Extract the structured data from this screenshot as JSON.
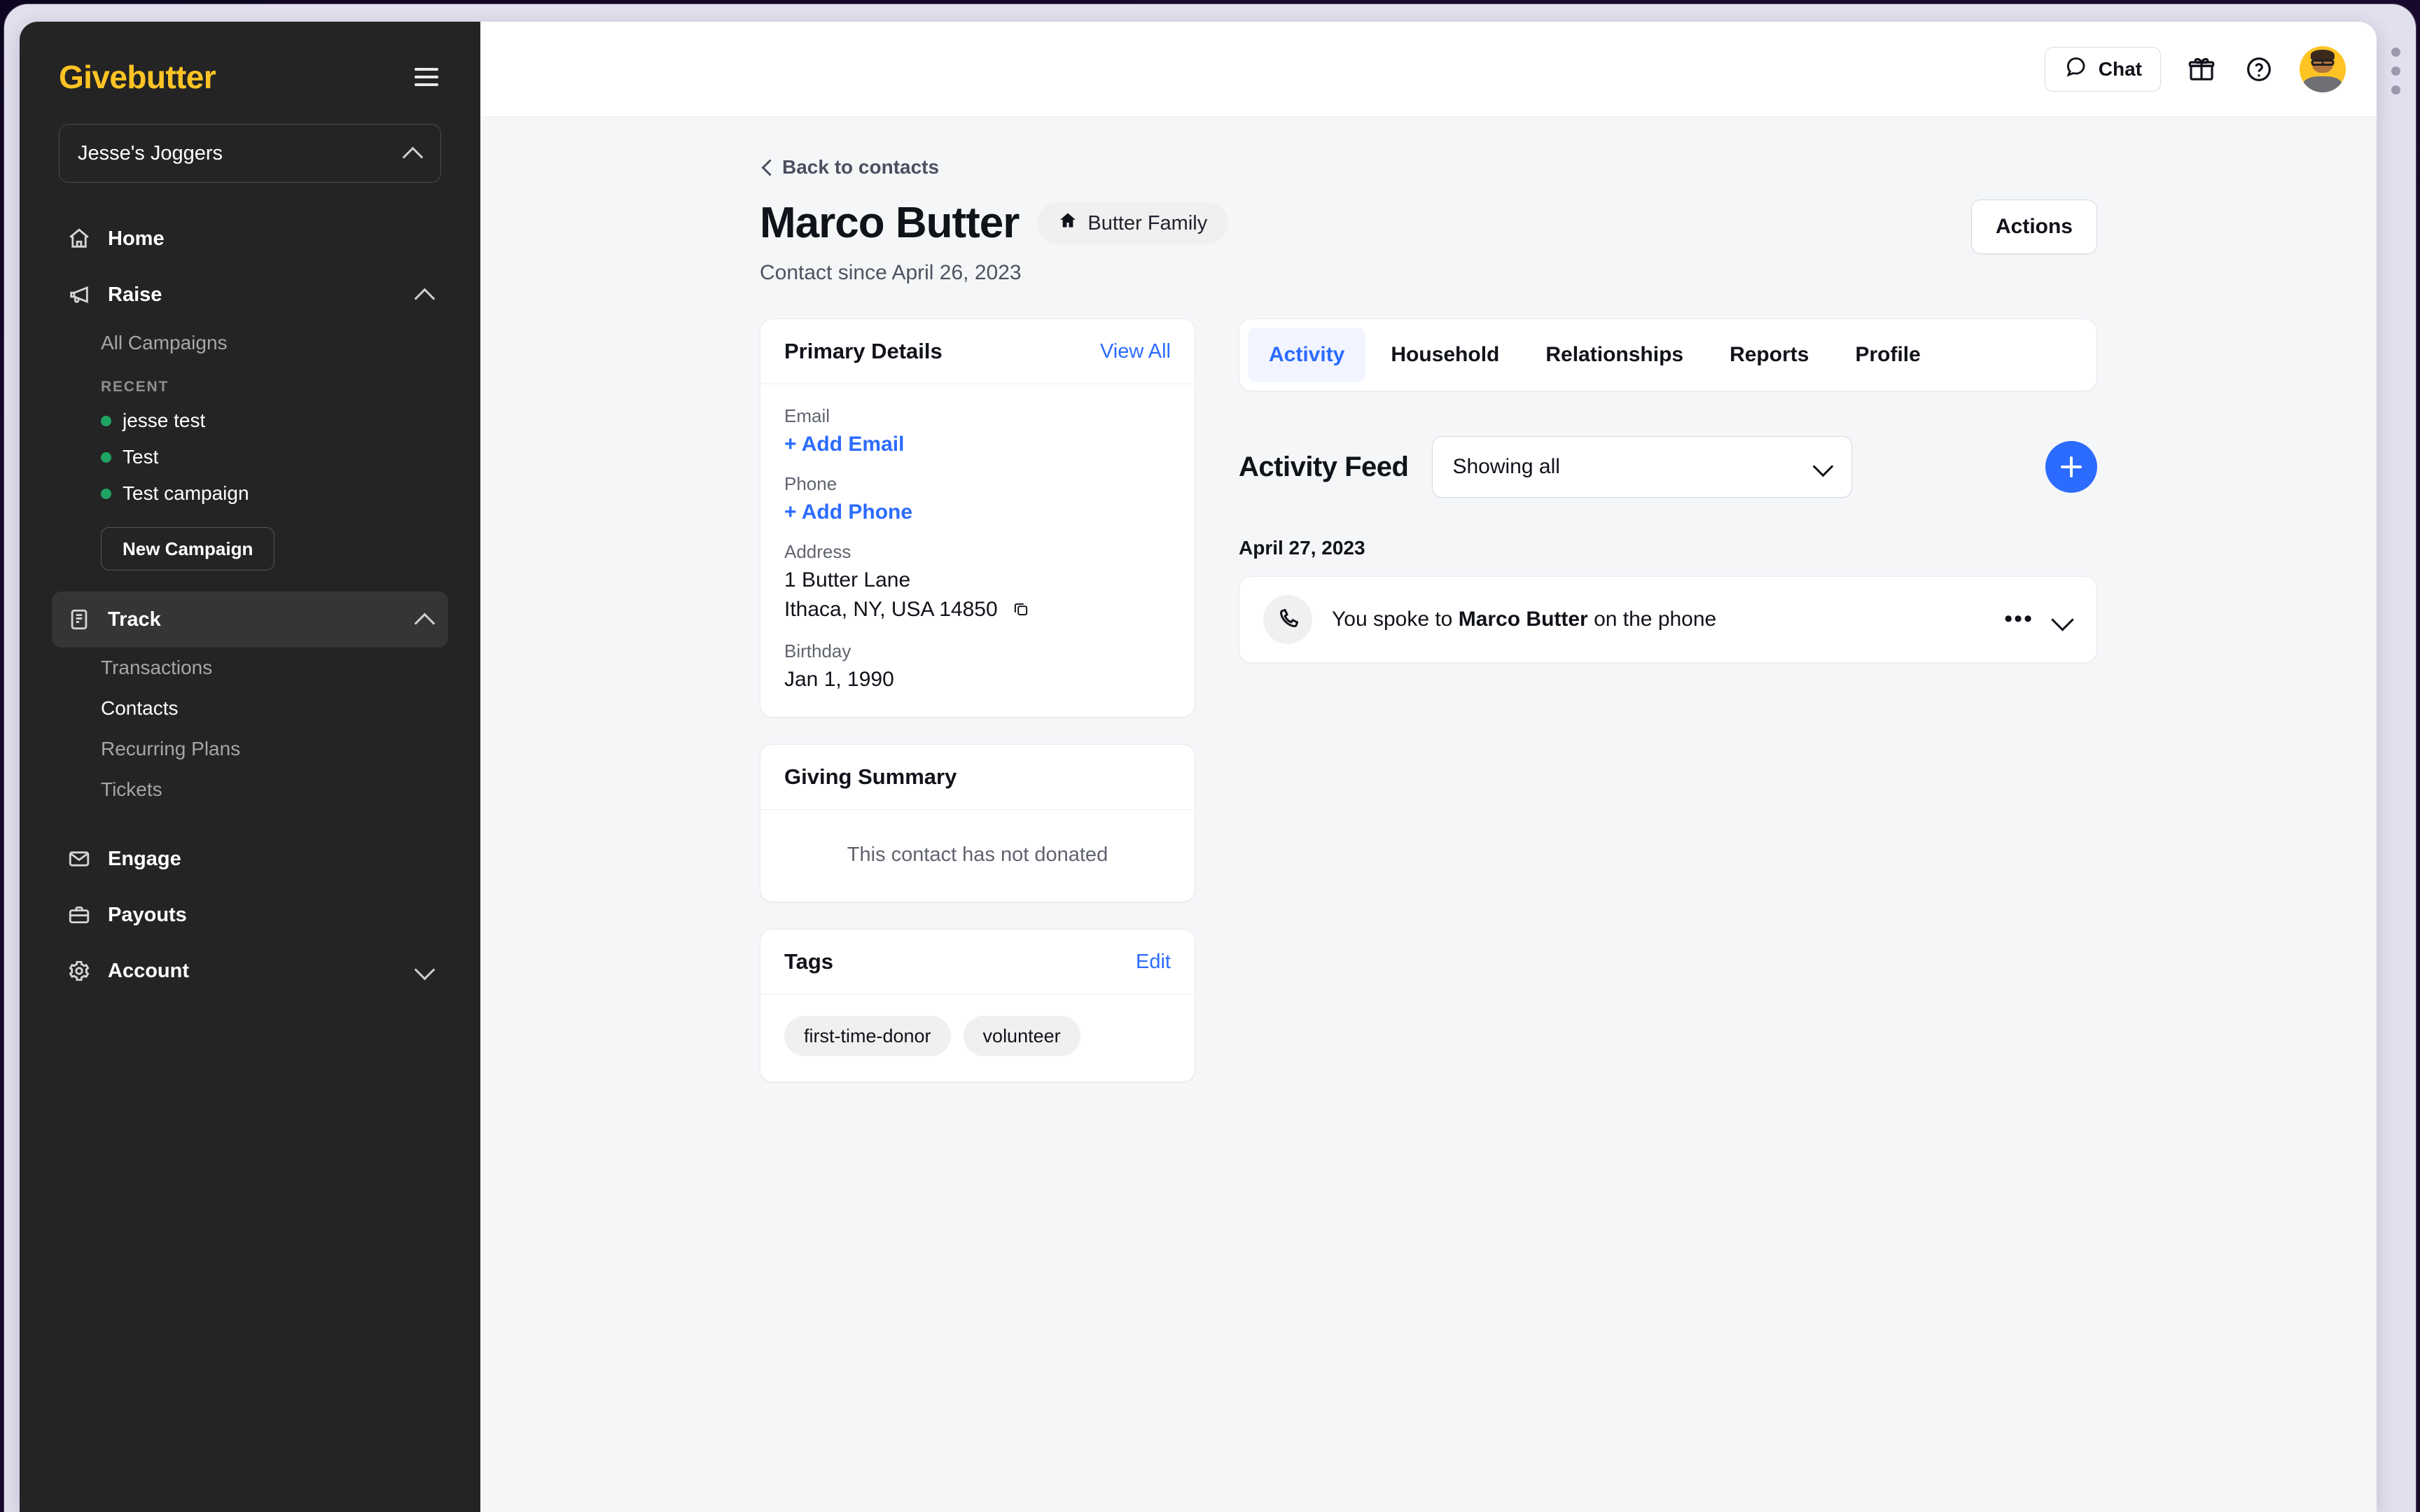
{
  "sidebar": {
    "brand": "Givebutter",
    "menu_icon": "hamburger-icon",
    "org": {
      "name": "Jesse's Joggers",
      "chevron": "chevron-up-icon"
    },
    "nav": {
      "home": "Home",
      "raise": "Raise",
      "all_campaigns": "All Campaigns",
      "recent_header": "RECENT",
      "recent": [
        "jesse test",
        "Test",
        "Test campaign"
      ],
      "new_campaign": "New Campaign",
      "track": "Track",
      "track_items": [
        "Transactions",
        "Contacts",
        "Recurring Plans",
        "Tickets"
      ],
      "engage": "Engage",
      "payouts": "Payouts",
      "account": "Account"
    },
    "active_item": "Contacts",
    "dot_color": "#1fa463",
    "brand_color": "#ffc424"
  },
  "topbar": {
    "chat_label": "Chat",
    "chat_icon": "chat-bubble-icon",
    "gift_icon": "gift-icon",
    "help_icon": "help-circle-icon",
    "avatar": "user-avatar"
  },
  "page": {
    "back_label": "Back to contacts",
    "contact_name": "Marco Butter",
    "household_label": "Butter Family",
    "household_icon": "home-icon",
    "since": "Contact since April 26, 2023",
    "actions_label": "Actions"
  },
  "primary_details": {
    "title": "Primary Details",
    "view_all": "View All",
    "fields": [
      {
        "label": "Email",
        "value": "+ Add Email",
        "type": "add"
      },
      {
        "label": "Phone",
        "value": "+ Add Phone",
        "type": "add"
      },
      {
        "label": "Address",
        "value": "1 Butter Lane",
        "value2": "Ithaca, NY, USA 14850",
        "type": "address",
        "copy_icon": "copy-icon"
      },
      {
        "label": "Birthday",
        "value": "Jan 1, 1990",
        "type": "text"
      }
    ]
  },
  "giving_summary": {
    "title": "Giving Summary",
    "empty_text": "This contact has not donated"
  },
  "tags_card": {
    "title": "Tags",
    "edit": "Edit",
    "tags": [
      "first-time-donor",
      "volunteer"
    ]
  },
  "tabs": {
    "items": [
      "Activity",
      "Household",
      "Relationships",
      "Reports",
      "Profile"
    ],
    "active": "Activity"
  },
  "activity": {
    "title": "Activity Feed",
    "filter_value": "Showing all",
    "filter_chevron": "chevron-down-icon",
    "add_icon": "plus-icon",
    "date_group": "April 27, 2023",
    "items": [
      {
        "icon": "phone-icon",
        "text_before": "You spoke to ",
        "text_bold": "Marco Butter",
        "text_after": " on the phone",
        "more_icon": "ellipsis-icon",
        "expand_icon": "chevron-down-icon"
      }
    ]
  },
  "colors": {
    "accent": "#2b6bff",
    "brand": "#ffc424",
    "sidebar_bg": "#242424",
    "page_bg": "#f5f6f8"
  }
}
